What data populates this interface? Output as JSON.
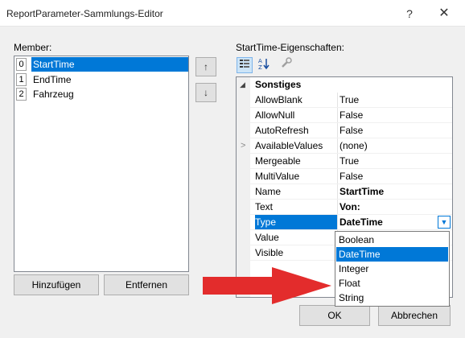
{
  "window": {
    "title": "ReportParameter-Sammlungs-Editor",
    "help": "?",
    "close": "✕"
  },
  "members": {
    "label": "Member:",
    "items": [
      {
        "index": "0",
        "name": "StartTime",
        "selected": true
      },
      {
        "index": "1",
        "name": "EndTime",
        "selected": false
      },
      {
        "index": "2",
        "name": "Fahrzeug",
        "selected": false
      }
    ],
    "move_up": "↑",
    "move_down": "↓",
    "add_label": "Hinzufügen",
    "remove_label": "Entfernen"
  },
  "properties": {
    "label": "StartTime-Eigenschaften:",
    "toolbar": {
      "categorized_icon": "categorized-icon",
      "alphabetical_icon": "alphabetical-icon",
      "property_pages_icon": "wrench-icon"
    },
    "category": "Sonstiges",
    "rows": [
      {
        "name": "AllowBlank",
        "value": "True",
        "bold": false
      },
      {
        "name": "AllowNull",
        "value": "False",
        "bold": false
      },
      {
        "name": "AutoRefresh",
        "value": "False",
        "bold": false
      },
      {
        "name": "AvailableValues",
        "value": "(none)",
        "bold": false,
        "expandable": true
      },
      {
        "name": "Mergeable",
        "value": "True",
        "bold": false
      },
      {
        "name": "MultiValue",
        "value": "False",
        "bold": false
      },
      {
        "name": "Name",
        "value": "StartTime",
        "bold": true
      },
      {
        "name": "Text",
        "value": "Von:",
        "bold": true
      },
      {
        "name": "Type",
        "value": "DateTime",
        "bold": true,
        "selected": true
      },
      {
        "name": "Value",
        "value": "",
        "bold": false
      },
      {
        "name": "Visible",
        "value": "",
        "bold": false
      }
    ],
    "type_options": [
      {
        "label": "Boolean",
        "selected": false
      },
      {
        "label": "DateTime",
        "selected": true
      },
      {
        "label": "Integer",
        "selected": false
      },
      {
        "label": "Float",
        "selected": false
      },
      {
        "label": "String",
        "selected": false
      }
    ]
  },
  "buttons": {
    "ok": "OK",
    "cancel": "Abbrechen"
  },
  "colors": {
    "accent": "#0078d7",
    "arrow": "#e32c2c"
  }
}
